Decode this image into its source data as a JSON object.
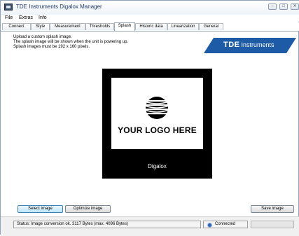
{
  "window": {
    "title": "TDE Instruments Digalox Manager",
    "controls": [
      "minimize-icon",
      "maximize-icon",
      "close-icon"
    ]
  },
  "menu": [
    "File",
    "Extras",
    "Info"
  ],
  "tabs": [
    {
      "label": "Connect"
    },
    {
      "label": "Style"
    },
    {
      "label": "Measurement"
    },
    {
      "label": "Thresholds"
    },
    {
      "label": "Splash",
      "active": true
    },
    {
      "label": "Historic data"
    },
    {
      "label": "Linearization"
    },
    {
      "label": "General"
    }
  ],
  "splash": {
    "description": [
      "Upload a custom splash image.",
      "The splash image will be shown when the unit is powering up.",
      "Splash images must be 192 x 160 pixels."
    ],
    "brand": {
      "name": "TDE",
      "suffix": "Instruments",
      "color": "#1e5ba6"
    },
    "preview": {
      "logo_text": "YOUR LOGO HERE",
      "device_name": "Digalox"
    }
  },
  "buttons": {
    "select_image": "Select image",
    "optimize_image": "Optimize image",
    "save_image": "Save image"
  },
  "status": {
    "text": "Status: Image conversion ok. 3117 Bytes (max. 4096 Bytes)",
    "connection": "Connected",
    "connection_color": "#2e64b8",
    "progress_percent": 0
  }
}
